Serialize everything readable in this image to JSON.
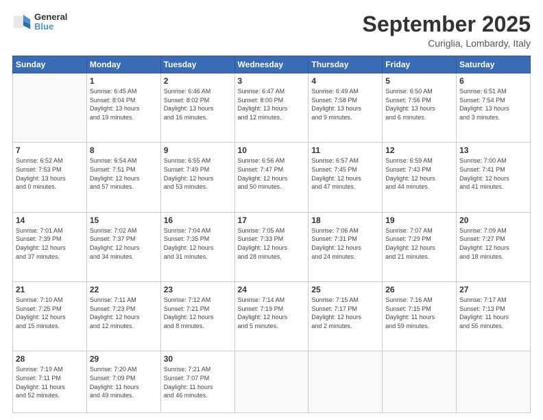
{
  "header": {
    "logo": {
      "line1": "General",
      "line2": "Blue"
    },
    "month": "September 2025",
    "location": "Curiglia, Lombardy, Italy"
  },
  "days_of_week": [
    "Sunday",
    "Monday",
    "Tuesday",
    "Wednesday",
    "Thursday",
    "Friday",
    "Saturday"
  ],
  "weeks": [
    [
      {
        "day": "",
        "info": ""
      },
      {
        "day": "1",
        "info": "Sunrise: 6:45 AM\nSunset: 8:04 PM\nDaylight: 13 hours\nand 19 minutes."
      },
      {
        "day": "2",
        "info": "Sunrise: 6:46 AM\nSunset: 8:02 PM\nDaylight: 13 hours\nand 16 minutes."
      },
      {
        "day": "3",
        "info": "Sunrise: 6:47 AM\nSunset: 8:00 PM\nDaylight: 13 hours\nand 12 minutes."
      },
      {
        "day": "4",
        "info": "Sunrise: 6:49 AM\nSunset: 7:58 PM\nDaylight: 13 hours\nand 9 minutes."
      },
      {
        "day": "5",
        "info": "Sunrise: 6:50 AM\nSunset: 7:56 PM\nDaylight: 13 hours\nand 6 minutes."
      },
      {
        "day": "6",
        "info": "Sunrise: 6:51 AM\nSunset: 7:54 PM\nDaylight: 13 hours\nand 3 minutes."
      }
    ],
    [
      {
        "day": "7",
        "info": "Sunrise: 6:52 AM\nSunset: 7:53 PM\nDaylight: 13 hours\nand 0 minutes."
      },
      {
        "day": "8",
        "info": "Sunrise: 6:54 AM\nSunset: 7:51 PM\nDaylight: 12 hours\nand 57 minutes."
      },
      {
        "day": "9",
        "info": "Sunrise: 6:55 AM\nSunset: 7:49 PM\nDaylight: 12 hours\nand 53 minutes."
      },
      {
        "day": "10",
        "info": "Sunrise: 6:56 AM\nSunset: 7:47 PM\nDaylight: 12 hours\nand 50 minutes."
      },
      {
        "day": "11",
        "info": "Sunrise: 6:57 AM\nSunset: 7:45 PM\nDaylight: 12 hours\nand 47 minutes."
      },
      {
        "day": "12",
        "info": "Sunrise: 6:59 AM\nSunset: 7:43 PM\nDaylight: 12 hours\nand 44 minutes."
      },
      {
        "day": "13",
        "info": "Sunrise: 7:00 AM\nSunset: 7:41 PM\nDaylight: 12 hours\nand 41 minutes."
      }
    ],
    [
      {
        "day": "14",
        "info": "Sunrise: 7:01 AM\nSunset: 7:39 PM\nDaylight: 12 hours\nand 37 minutes."
      },
      {
        "day": "15",
        "info": "Sunrise: 7:02 AM\nSunset: 7:37 PM\nDaylight: 12 hours\nand 34 minutes."
      },
      {
        "day": "16",
        "info": "Sunrise: 7:04 AM\nSunset: 7:35 PM\nDaylight: 12 hours\nand 31 minutes."
      },
      {
        "day": "17",
        "info": "Sunrise: 7:05 AM\nSunset: 7:33 PM\nDaylight: 12 hours\nand 28 minutes."
      },
      {
        "day": "18",
        "info": "Sunrise: 7:06 AM\nSunset: 7:31 PM\nDaylight: 12 hours\nand 24 minutes."
      },
      {
        "day": "19",
        "info": "Sunrise: 7:07 AM\nSunset: 7:29 PM\nDaylight: 12 hours\nand 21 minutes."
      },
      {
        "day": "20",
        "info": "Sunrise: 7:09 AM\nSunset: 7:27 PM\nDaylight: 12 hours\nand 18 minutes."
      }
    ],
    [
      {
        "day": "21",
        "info": "Sunrise: 7:10 AM\nSunset: 7:25 PM\nDaylight: 12 hours\nand 15 minutes."
      },
      {
        "day": "22",
        "info": "Sunrise: 7:11 AM\nSunset: 7:23 PM\nDaylight: 12 hours\nand 12 minutes."
      },
      {
        "day": "23",
        "info": "Sunrise: 7:12 AM\nSunset: 7:21 PM\nDaylight: 12 hours\nand 8 minutes."
      },
      {
        "day": "24",
        "info": "Sunrise: 7:14 AM\nSunset: 7:19 PM\nDaylight: 12 hours\nand 5 minutes."
      },
      {
        "day": "25",
        "info": "Sunrise: 7:15 AM\nSunset: 7:17 PM\nDaylight: 12 hours\nand 2 minutes."
      },
      {
        "day": "26",
        "info": "Sunrise: 7:16 AM\nSunset: 7:15 PM\nDaylight: 11 hours\nand 59 minutes."
      },
      {
        "day": "27",
        "info": "Sunrise: 7:17 AM\nSunset: 7:13 PM\nDaylight: 11 hours\nand 55 minutes."
      }
    ],
    [
      {
        "day": "28",
        "info": "Sunrise: 7:19 AM\nSunset: 7:11 PM\nDaylight: 11 hours\nand 52 minutes."
      },
      {
        "day": "29",
        "info": "Sunrise: 7:20 AM\nSunset: 7:09 PM\nDaylight: 11 hours\nand 49 minutes."
      },
      {
        "day": "30",
        "info": "Sunrise: 7:21 AM\nSunset: 7:07 PM\nDaylight: 11 hours\nand 46 minutes."
      },
      {
        "day": "",
        "info": ""
      },
      {
        "day": "",
        "info": ""
      },
      {
        "day": "",
        "info": ""
      },
      {
        "day": "",
        "info": ""
      }
    ]
  ]
}
